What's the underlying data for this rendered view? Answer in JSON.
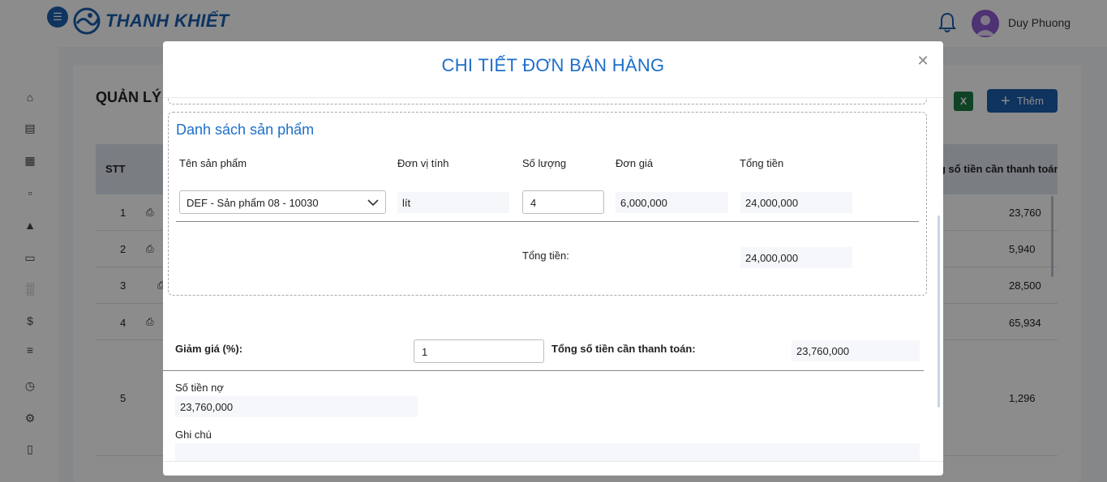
{
  "app": {
    "brand": "THANH KHIẾT",
    "user_name": "Duy Phuong"
  },
  "page": {
    "title": "QUẢN LÝ",
    "add_label": "Thêm",
    "excel_label": "X"
  },
  "table": {
    "col_stt": "STT",
    "col_total": "ng số tiền cần thanh toán",
    "rows": [
      {
        "stt": "1",
        "amount": "23,760"
      },
      {
        "stt": "2",
        "amount": "5,940"
      },
      {
        "stt": "3",
        "amount": "28,500"
      },
      {
        "stt": "4",
        "amount": "65,934"
      },
      {
        "stt": "5",
        "amount": "1,296"
      }
    ]
  },
  "modal": {
    "title": "CHI TIẾT ĐƠN BÁN HÀNG",
    "close_icon": "close-icon",
    "products": {
      "section_title": "Danh sách sản phẩm",
      "headers": {
        "name": "Tên sản phẩm",
        "unit": "Đơn vị tính",
        "qty": "Số lượng",
        "price": "Đơn giá",
        "total": "Tổng tiền"
      },
      "items": [
        {
          "name": "DEF - Sản phẩm 08 - 10030",
          "unit": "lít",
          "qty": "4",
          "price": "6,000,000",
          "total": "24,000,000"
        }
      ],
      "sum_label": "Tổng tiền:",
      "sum_value": "24,000,000"
    },
    "discount_label": "Giảm giá (%):",
    "discount_value": "1",
    "payable_label": "Tổng số tiền cần thanh toán:",
    "payable_value": "23,760,000",
    "debt_label": "Số tiền nợ",
    "debt_value": "23,760,000",
    "note_label": "Ghi chú"
  },
  "colors": {
    "brand": "#1b5fae",
    "title": "#1e6fc9"
  }
}
